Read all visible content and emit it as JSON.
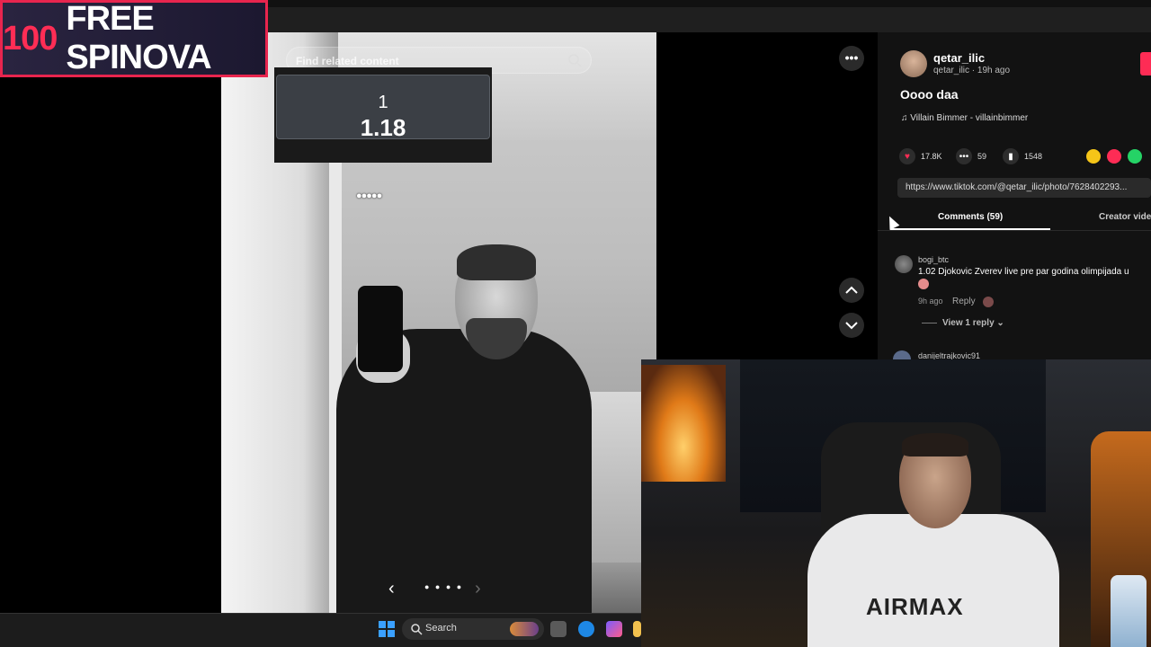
{
  "promo": {
    "number": "100",
    "text": "FREE SPINOVA"
  },
  "viewer": {
    "search_placeholder": "Find related content",
    "odds_index": "1",
    "odds_value": "1.18",
    "dots": "●●●●●",
    "nav_prev": "‹",
    "nav_dots": "● ● ● ●",
    "nav_next": "›",
    "more": "•••"
  },
  "post": {
    "username": "qetar_ilic",
    "subline": "qetar_ilic · 19h ago",
    "caption": "Oooo daa",
    "music_icon": "♫",
    "music": "Villain Bimmer - villainbimmer",
    "likes": "17.8K",
    "comments_count": "59",
    "saves": "1548",
    "link": "https://www.tiktok.com/@qetar_ilic/photo/7628402293...",
    "share_colors": [
      "#f5c518",
      "#fe2c55",
      "#25d366",
      "#1d9bf0"
    ]
  },
  "tabs": {
    "comments": "Comments (59)",
    "creator": "Creator videos"
  },
  "comments": [
    {
      "user": "bogi_btc",
      "text": "1.02 Djokovic Zverev live pre par godina olimpijada u ",
      "time": "9h ago",
      "reply": "Reply",
      "view_replies": "View 1 reply ⌄"
    },
    {
      "user": "danijeltrajkovic91"
    }
  ],
  "webcam": {
    "shirt_print": "AIRMAX"
  },
  "taskbar": {
    "search_label": "Search"
  },
  "colors": {
    "accent": "#fe2c55",
    "win_blue": "#3aa0ff"
  }
}
